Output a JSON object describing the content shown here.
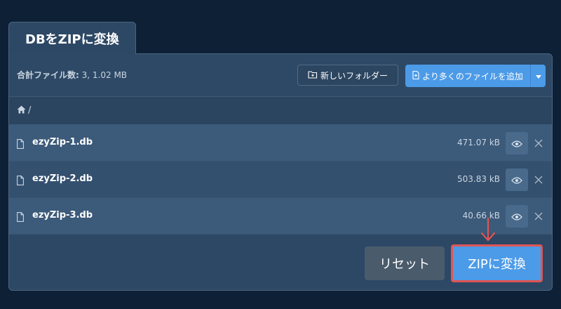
{
  "tab": {
    "title": "DBをZIPに変換"
  },
  "toolbar": {
    "file_count_label": "合計ファイル数:",
    "file_count_value": "3, 1.02 MB",
    "new_folder_label": "新しいフォルダー",
    "add_files_label": "より多くのファイルを追加"
  },
  "breadcrumb": {
    "path": "/"
  },
  "files": [
    {
      "name": "ezyZip-1.db",
      "size": "471.07 kB"
    },
    {
      "name": "ezyZip-2.db",
      "size": "503.83 kB"
    },
    {
      "name": "ezyZip-3.db",
      "size": "40.66 kB"
    }
  ],
  "actions": {
    "reset_label": "リセット",
    "convert_label": "ZIPに変換"
  },
  "colors": {
    "background": "#0e2035",
    "panel": "#2d4865",
    "accent": "#4c9be8",
    "highlight": "#e05555",
    "reset": "#4a5b6c"
  },
  "icons": {
    "folder": "new-folder-icon",
    "file_add": "file-add-icon",
    "caret": "caret-down-icon",
    "home": "home-icon",
    "file": "file-icon",
    "eye": "eye-icon",
    "close": "close-icon",
    "arrow": "arrow-down-icon"
  }
}
